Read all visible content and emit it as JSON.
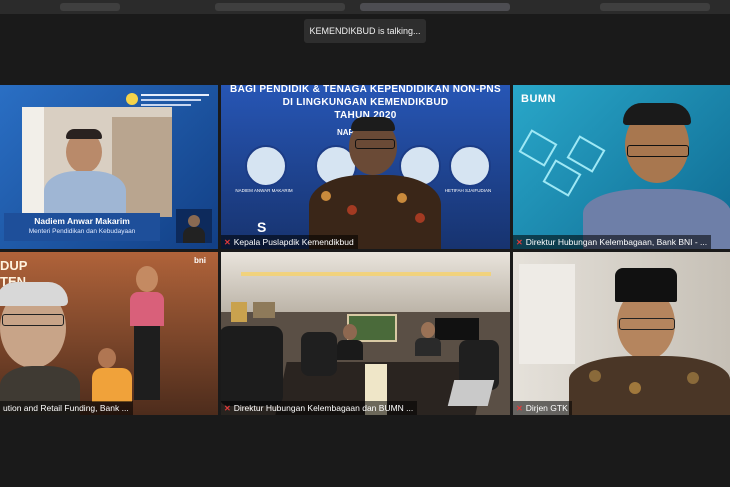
{
  "speaker_indicator": "KEMENDIKBUD is talking...",
  "tiles": [
    {
      "name": "",
      "lower_third": {
        "name": "Nadiem Anwar Makarim",
        "title": "Menteri Pendidikan dan Kebudayaan"
      }
    },
    {
      "name": "Kepala Puslapdik Kemendikbud",
      "slide": {
        "line1": "BAGI PENDIDIK & TENAGA KEPENDIDIKAN NON-PNS",
        "line2": "DI LINGKUNGAN KEMENDIKBUD",
        "line3": "TAHUN 2020",
        "narasumber": "NARA",
        "caption1": "NADIEM ANWAR MAKARIM",
        "caption2": "SRI MU",
        "caption4": "HETIFAH SJAIFUDIAN"
      }
    },
    {
      "name": "Direktur Hubungan Kelembagaan, Bank BNI - ...",
      "logo": "BUMN"
    },
    {
      "name": "ution and Retail Funding, Bank ...",
      "banner": "DUP",
      "banner2": "TEN",
      "brand": "bni"
    },
    {
      "name": "Direktur Hubungan Kelembagaan dan BUMN ..."
    },
    {
      "name": "Dirjen GTK"
    }
  ],
  "colors": {
    "active_outline": "#c8d62a",
    "mic_muted": "#e03a3a"
  }
}
